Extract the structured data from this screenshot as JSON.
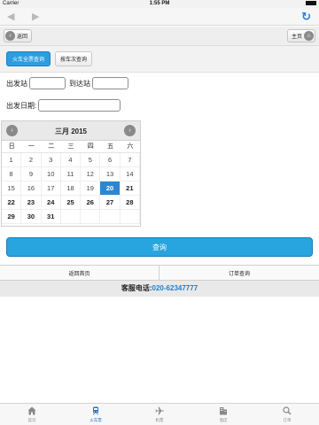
{
  "status": {
    "carrier": "Carrier",
    "time": "1:55 PM"
  },
  "browser": {
    "back_icon": "arrow-left-icon",
    "forward_icon": "arrow-right-icon",
    "reload_icon": "reload-icon"
  },
  "header": {
    "back_label": "返回",
    "home_label": "主页"
  },
  "tabs": [
    {
      "label": "火车全票查询",
      "active": true
    },
    {
      "label": "按车次查询",
      "active": false
    }
  ],
  "form": {
    "depart_label": "出发站",
    "arrive_label": "到达站",
    "date_label": "出发日期:",
    "depart_value": "",
    "arrive_value": "",
    "date_value": ""
  },
  "calendar": {
    "title": "三月 2015",
    "weekdays": [
      "日",
      "一",
      "二",
      "三",
      "四",
      "五",
      "六"
    ],
    "days": [
      [
        "1",
        "2",
        "3",
        "4",
        "5",
        "6",
        "7"
      ],
      [
        "8",
        "9",
        "10",
        "11",
        "12",
        "13",
        "14"
      ],
      [
        "15",
        "16",
        "17",
        "18",
        "19",
        "20",
        "21"
      ],
      [
        "22",
        "23",
        "24",
        "25",
        "26",
        "27",
        "28"
      ],
      [
        "29",
        "30",
        "31",
        "",
        "",
        "",
        ""
      ]
    ],
    "selected": "20"
  },
  "query_button": "查询",
  "bottom_links": {
    "home": "返回首页",
    "orders": "订单查询"
  },
  "service": {
    "label": "客服电话:",
    "phone": "020-62347777"
  },
  "tabbar": [
    {
      "label": "首页",
      "icon": "home-icon",
      "active": false
    },
    {
      "label": "火车票",
      "icon": "train-icon",
      "active": true
    },
    {
      "label": "机票",
      "icon": "plane-icon",
      "active": false
    },
    {
      "label": "酒店",
      "icon": "hotel-icon",
      "active": false
    },
    {
      "label": "订单",
      "icon": "search-icon",
      "active": false
    }
  ],
  "colors": {
    "accent": "#28a5df",
    "selected_day": "#2d86d2",
    "phone": "#1e7fd0"
  }
}
